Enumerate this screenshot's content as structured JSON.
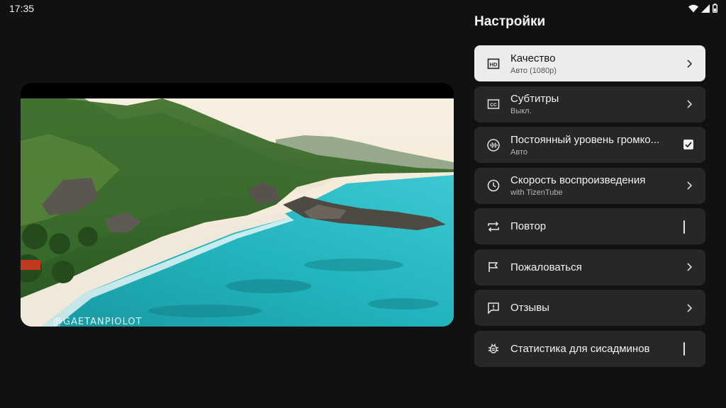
{
  "status_bar": {
    "time": "17:35",
    "icons": [
      "wifi-icon",
      "signal-icon",
      "battery-icon"
    ]
  },
  "video": {
    "watermark": "@GAETANPIOLOT"
  },
  "settings": {
    "title": "Настройки",
    "items": [
      {
        "label": "Качество",
        "sub": "Авто (1080p)",
        "icon": "hd-icon",
        "trail": "chevron",
        "selected": true
      },
      {
        "label": "Субтитры",
        "sub": "Выкл.",
        "icon": "cc-icon",
        "trail": "chevron"
      },
      {
        "label": "Постоянный уровень громко...",
        "sub": "Авто",
        "icon": "audio-wave-icon",
        "trail": "checkbox-checked"
      },
      {
        "label": "Скорость воспроизведения",
        "sub": "with TizenTube",
        "icon": "clock-icon",
        "trail": "chevron"
      },
      {
        "label": "Повтор",
        "icon": "repeat-icon",
        "trail": "checkbox-unchecked"
      },
      {
        "label": "Пожаловаться",
        "icon": "flag-icon",
        "trail": "chevron"
      },
      {
        "label": "Отзывы",
        "icon": "feedback-icon",
        "trail": "chevron"
      },
      {
        "label": "Статистика для сисадминов",
        "icon": "bug-icon",
        "trail": "checkbox-unchecked"
      }
    ]
  }
}
